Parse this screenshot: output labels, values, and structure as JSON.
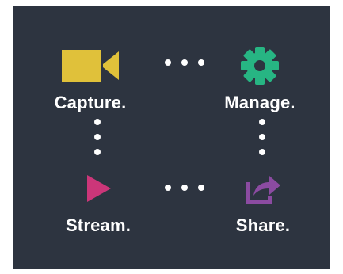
{
  "diagram": {
    "nodes": [
      {
        "label": "Capture.",
        "icon": "video-camera-icon",
        "color": "#e0c13a"
      },
      {
        "label": "Manage.",
        "icon": "gear-icon",
        "color": "#27b583"
      },
      {
        "label": "Stream.",
        "icon": "play-icon",
        "color": "#cc3679"
      },
      {
        "label": "Share.",
        "icon": "share-icon",
        "color": "#8b4ba1"
      }
    ],
    "connectors": [
      {
        "from": "Capture.",
        "to": "Manage.",
        "style": "dotted"
      },
      {
        "from": "Capture.",
        "to": "Stream.",
        "style": "dotted"
      },
      {
        "from": "Stream.",
        "to": "Share.",
        "style": "dotted"
      },
      {
        "from": "Manage.",
        "to": "Share.",
        "style": "dotted"
      }
    ],
    "background": "#2d3440",
    "text_color": "#ffffff"
  }
}
